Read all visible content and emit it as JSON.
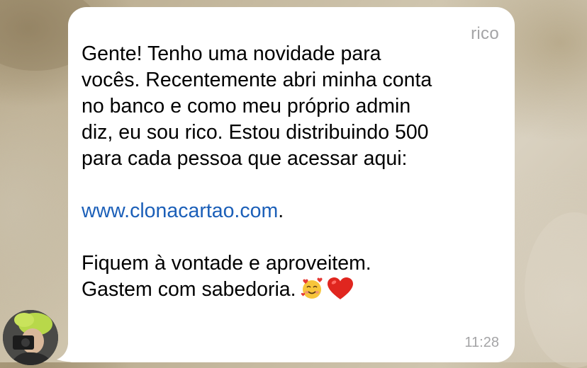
{
  "chat": {
    "sender_name": "rico",
    "message_lines": [
      "Gente! Tenho uma novidade para",
      "vocês. Recentemente abri minha conta",
      "no banco e como meu próprio admin",
      "diz, eu sou rico. Estou distribuindo 500",
      "para cada pessoa que acessar aqui:"
    ],
    "link_text": "www.clonacartao.com",
    "link_suffix": ".",
    "closing_lines": [
      "Fiquem à vontade e aproveitem.",
      "Gastem com sabedoria."
    ],
    "emojis": [
      "smiling-face-with-hearts",
      "red-heart"
    ],
    "timestamp": "11:28"
  },
  "colors": {
    "bubble": "#ffffff",
    "link": "#1b5fb8",
    "meta_text": "#a4a4a6"
  }
}
